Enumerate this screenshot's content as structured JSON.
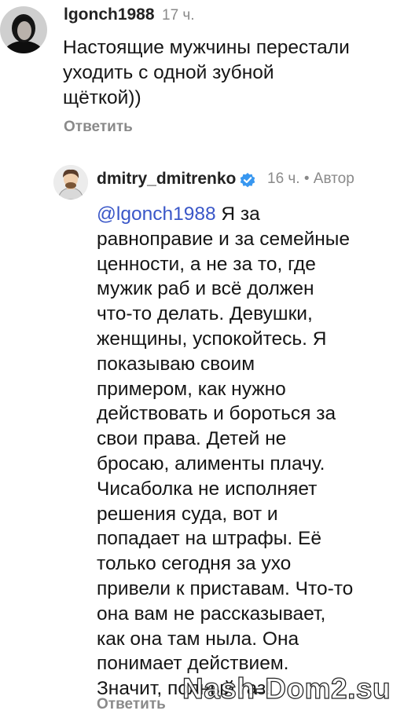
{
  "comments": [
    {
      "username": "lgonch1988",
      "time": "17 ч.",
      "lines": [
        "Настоящие мужчины перестали",
        "уходить с одной зубной",
        "щёткой))"
      ],
      "reply_label": "Ответить"
    },
    {
      "username": "dmitry_dmitrenko",
      "meta": "16 ч. • Автор",
      "verified_icon": "verified-badge-icon",
      "mention": "@lgonch1988",
      "lines": [
        " Я за",
        "равноправие и за семейные",
        "ценности, а не за то, где",
        "мужик раб и всё должен",
        "что-то делать. Девушки,",
        "женщины, успокойтесь. Я",
        "показываю своим",
        "примером, как нужно",
        "действовать и бороться за",
        "свои права. Детей не",
        "бросаю, алименты плачу.",
        "Чисаболка не исполняет",
        "решения суда, вот и",
        "попадает на штрафы. Её",
        "только сегодня за ухо",
        "привели к приставам. Что-то",
        "она вам не рассказывает,",
        "как она там ныла. Она",
        "понимает действием.",
        "Значит, полный газ!"
      ],
      "reply_label": "Ответить"
    }
  ],
  "watermark": "Nash-Dom2.su",
  "colors": {
    "mention": "#3a57c8",
    "verified": "#3897f0",
    "meta": "#8a8a8a"
  }
}
